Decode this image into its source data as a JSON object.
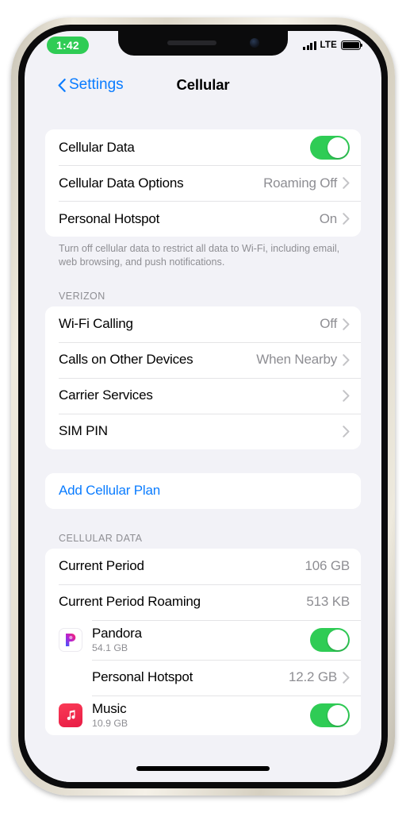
{
  "status_bar": {
    "time": "1:42",
    "time_pill_color": "#2fcc55",
    "network_type": "LTE",
    "signal_bars": 4,
    "battery_level": 100
  },
  "nav": {
    "back_label": "Settings",
    "title": "Cellular",
    "accent_color": "#0a7cff"
  },
  "groups": {
    "data_group": {
      "rows": [
        {
          "label": "Cellular Data",
          "control": "toggle",
          "value": "On"
        },
        {
          "label": "Cellular Data Options",
          "value": "Roaming Off",
          "control": "chevron"
        },
        {
          "label": "Personal Hotspot",
          "value": "On",
          "control": "chevron"
        }
      ],
      "footer": "Turn off cellular data to restrict all data to Wi-Fi, including email, web browsing, and push notifications."
    },
    "carrier_group": {
      "header": "VERIZON",
      "rows": [
        {
          "label": "Wi-Fi Calling",
          "value": "Off",
          "control": "chevron"
        },
        {
          "label": "Calls on Other Devices",
          "value": "When Nearby",
          "control": "chevron"
        },
        {
          "label": "Carrier Services",
          "value": "",
          "control": "chevron"
        },
        {
          "label": "SIM PIN",
          "value": "",
          "control": "chevron"
        }
      ]
    },
    "add_plan_group": {
      "label": "Add Cellular Plan"
    },
    "cellular_data_group": {
      "header": "CELLULAR DATA",
      "rows": [
        {
          "label": "Current Period",
          "value": "106 GB"
        },
        {
          "label": "Current Period Roaming",
          "value": "513 KB"
        }
      ],
      "apps": [
        {
          "name": "Pandora",
          "size": "54.1 GB",
          "icon": "pandora-icon",
          "control": "toggle"
        },
        {
          "name": "Personal Hotspot",
          "size": "12.2 GB",
          "icon": "",
          "control": "chevron",
          "indented": true
        },
        {
          "name": "Music",
          "size": "10.9 GB",
          "icon": "music-icon",
          "control": "toggle"
        }
      ]
    }
  },
  "colors": {
    "toggle_on": "#2fcc55",
    "background": "#f2f2f7",
    "card": "#ffffff",
    "secondary_text": "#8e8e93"
  }
}
